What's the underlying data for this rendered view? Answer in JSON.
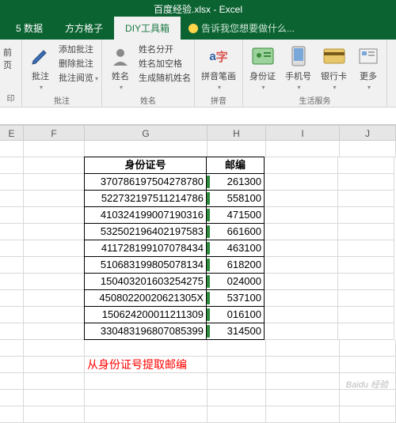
{
  "title": "百度经验.xlsx - Excel",
  "tabs": {
    "t1": "5 数据",
    "t2": "方方格子",
    "t3": "DIY工具箱"
  },
  "tellme": "告诉我您想要做什么...",
  "ribbon": {
    "left": {
      "l1": "前页",
      "l2": "印"
    },
    "g1": {
      "big": "批注",
      "s1": "添加批注",
      "s2": "删除批注",
      "s3": "批注阅览",
      "label": "批注"
    },
    "g2": {
      "big": "姓名",
      "s1": "姓名分开",
      "s2": "姓名加空格",
      "s3": "生成随机姓名",
      "label": "姓名"
    },
    "g3": {
      "big": "拼音笔画",
      "label": "拼音"
    },
    "g4": {
      "b1": "身份证",
      "b2": "手机号",
      "b3": "银行卡",
      "b4": "更多",
      "label": "生活服务"
    }
  },
  "cols": {
    "E": "E",
    "F": "F",
    "G": "G",
    "H": "H",
    "I": "I",
    "J": "J"
  },
  "headers": {
    "g": "身份证号",
    "h": "邮编"
  },
  "note": "从身份证号提取邮编",
  "watermark": "Baidu 经验",
  "chart_data": {
    "type": "table",
    "columns": [
      "身份证号",
      "邮编"
    ],
    "rows": [
      [
        "370786197504278780",
        "261300"
      ],
      [
        "522732197511214786",
        "558100"
      ],
      [
        "410324199007190316",
        "471500"
      ],
      [
        "532502196402197583",
        "661600"
      ],
      [
        "411728199107078434",
        "463100"
      ],
      [
        "510683199805078134",
        "618200"
      ],
      [
        "150403201603254275",
        "024000"
      ],
      [
        "45080220020621305X",
        "537100"
      ],
      [
        "150624200011211309",
        "016100"
      ],
      [
        "330483196807085399",
        "314500"
      ]
    ]
  }
}
